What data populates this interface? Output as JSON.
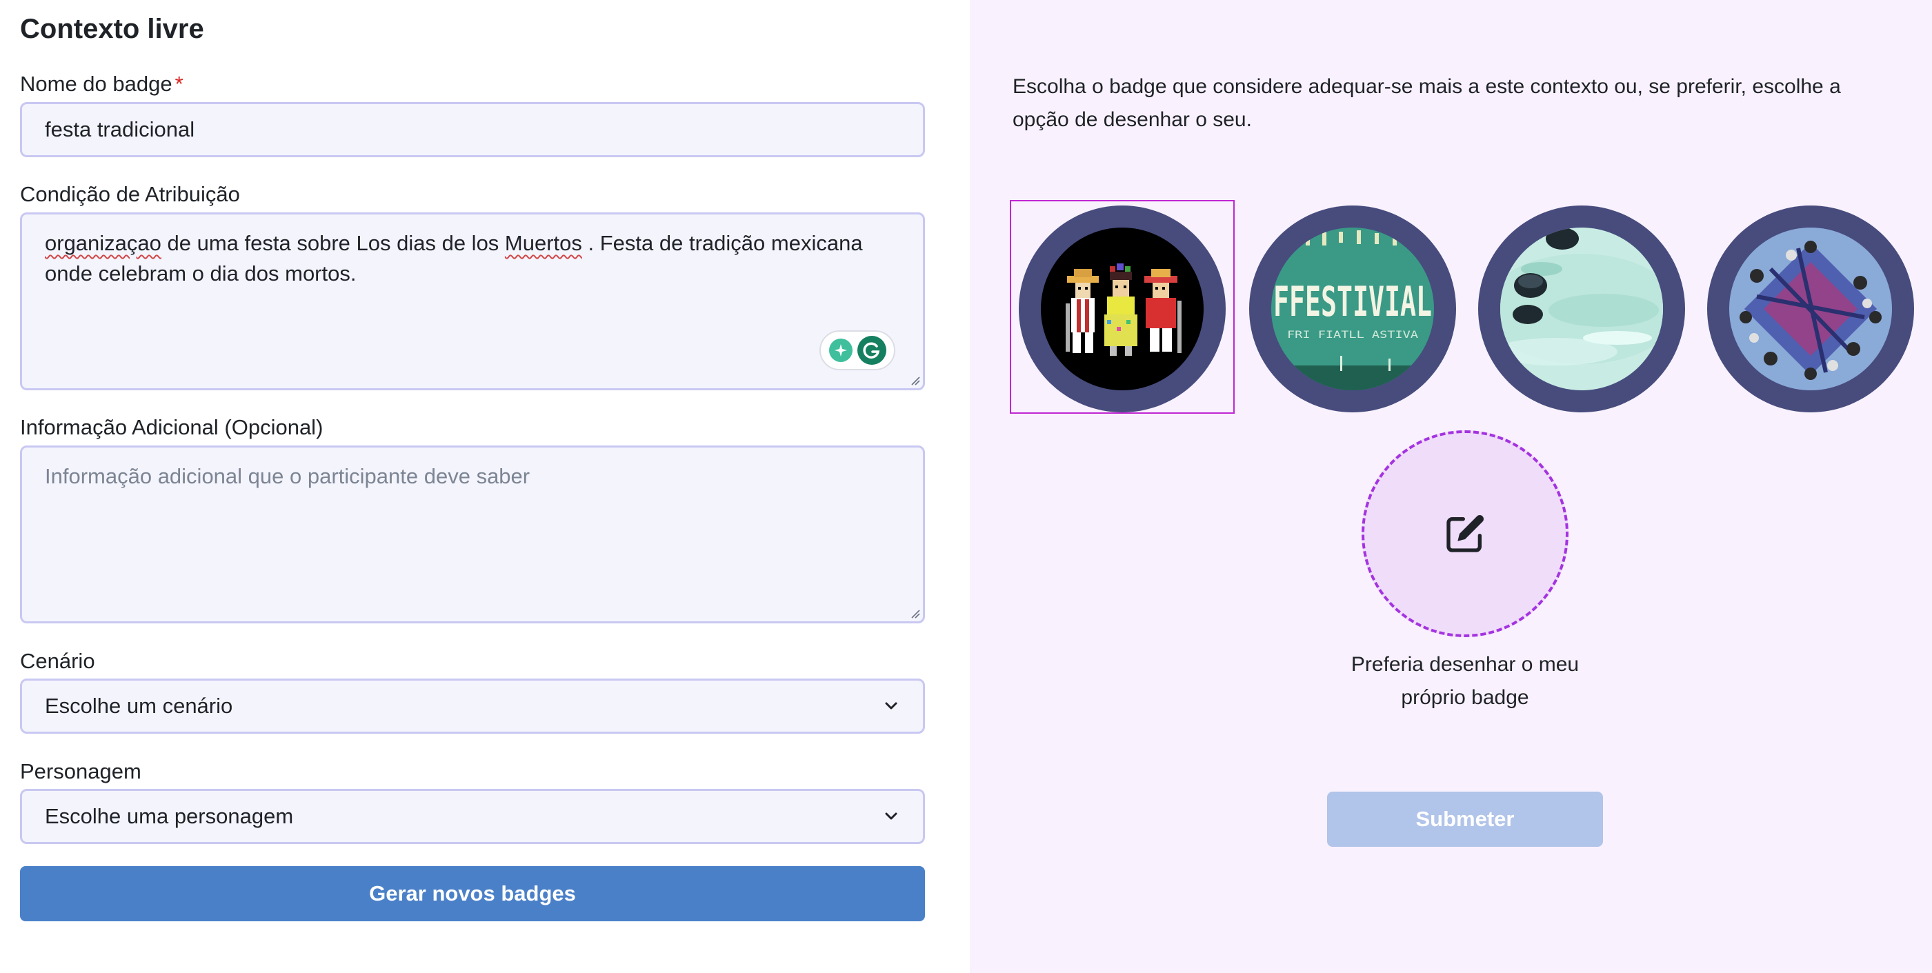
{
  "form": {
    "title": "Contexto livre",
    "badge_name": {
      "label": "Nome do badge",
      "required_mark": "*",
      "value": "festa tradicional"
    },
    "condition": {
      "label": "Condição de Atribuição",
      "value_words": [
        "organizaçao",
        " de uma festa  sobre  Los dias de los ",
        "Muertos",
        " . Festa de tradição mexicana onde celebram o dia dos mortos."
      ]
    },
    "additional": {
      "label": "Informação Adicional (Opcional)",
      "placeholder": "Informação adicional que o participante deve saber"
    },
    "scenario": {
      "label": "Cenário",
      "selected": "Escolhe um cenário"
    },
    "character": {
      "label": "Personagem",
      "selected": "Escolhe uma personagem"
    },
    "generate_button": "Gerar novos badges"
  },
  "badges": {
    "instructions": "Escolha o badge que considere adequar-se mais a este contexto ou, se preferir, escolhe a opção de desenhar o seu.",
    "items": [
      {
        "name": "badge-dia-de-los-muertos",
        "selected": true
      },
      {
        "name": "badge-festival",
        "selected": false,
        "text": "FFESTIVIAL",
        "subtext": "FRI FIATLL ASTIVA"
      },
      {
        "name": "badge-water",
        "selected": false
      },
      {
        "name": "badge-crowd",
        "selected": false
      }
    ],
    "draw_own_label": "Preferia desenhar o meu próprio badge",
    "submit_button": "Submeter"
  },
  "icons": {
    "chevron": "chevron-down-icon",
    "edit": "pencil-square-icon",
    "grammarly": "grammarly-icon"
  },
  "colors": {
    "accent_blue": "#4a80c8",
    "submit_disabled": "#b1c4e9",
    "selected_border": "#c026d3",
    "badge_ring": "#474c7d",
    "dashed_purple": "#a433e0",
    "required_red": "#dc2626"
  }
}
